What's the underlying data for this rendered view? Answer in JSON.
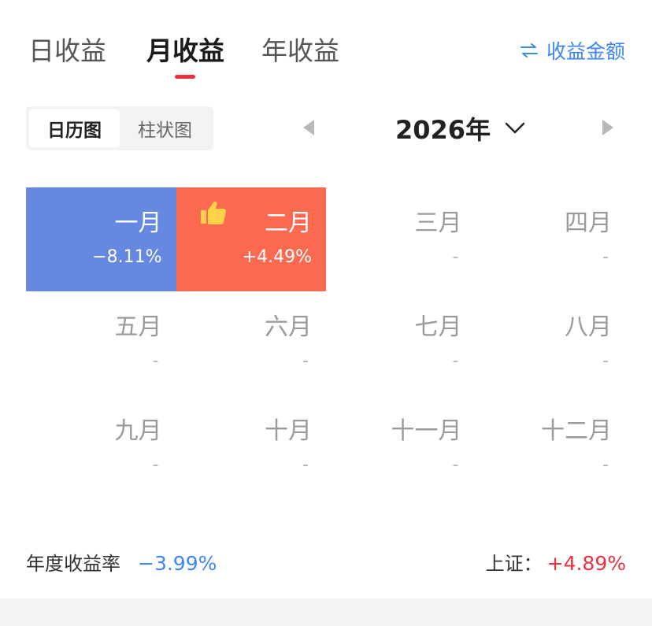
{
  "tabs": [
    {
      "label": "日收益"
    },
    {
      "label": "月收益"
    },
    {
      "label": "年收益"
    }
  ],
  "swap_link": {
    "label": "收益金额",
    "icon": "swap-arrows-icon"
  },
  "view_toggle": {
    "options": [
      "日历图",
      "柱状图"
    ],
    "selected": "日历图"
  },
  "year_selector": {
    "label": "2026年"
  },
  "months": [
    {
      "name": "一月",
      "value": "−8.11%",
      "state": "down"
    },
    {
      "name": "二月",
      "value": "+4.49%",
      "state": "up",
      "badge_icon": "thumbs-up-icon"
    },
    {
      "name": "三月",
      "value": "-"
    },
    {
      "name": "四月",
      "value": "-"
    },
    {
      "name": "五月",
      "value": "-"
    },
    {
      "name": "六月",
      "value": "-"
    },
    {
      "name": "七月",
      "value": "-"
    },
    {
      "name": "八月",
      "value": "-"
    },
    {
      "name": "九月",
      "value": "-"
    },
    {
      "name": "十月",
      "value": "-"
    },
    {
      "name": "十一月",
      "value": "-"
    },
    {
      "name": "十二月",
      "value": "-"
    }
  ],
  "footer": {
    "annual_label": "年度收益率",
    "annual_value": "−3.99%",
    "index_label": "上证：",
    "index_value": "+4.89%"
  },
  "colors": {
    "active_tab_indicator": "#e8333f",
    "negative_month": "#6588e3",
    "positive_month": "#fb6a50",
    "blue_text": "#3c86f0",
    "red_text": "#e8333f"
  }
}
